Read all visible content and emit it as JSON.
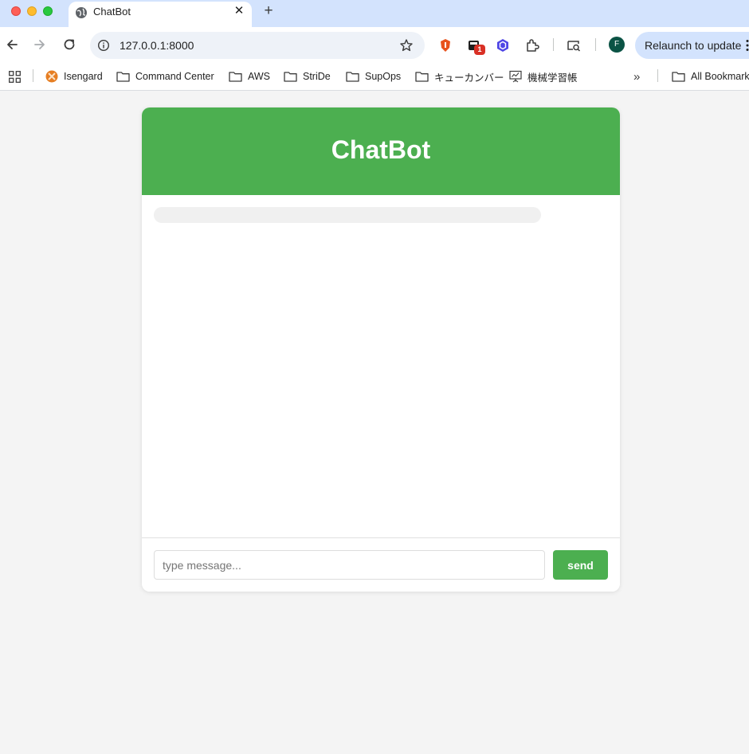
{
  "browser": {
    "tab": {
      "title": "ChatBot",
      "close_glyph": "✕",
      "favicon": "globe-icon"
    },
    "new_tab_glyph": "+",
    "address_bar": {
      "url": "127.0.0.1:8000"
    },
    "profile": {
      "initial": "F",
      "color": "#0b5345"
    },
    "extensions": [
      {
        "name": "brave-lion-icon",
        "color": "#e8531d"
      },
      {
        "name": "extension-badge-icon",
        "badge": "1"
      },
      {
        "name": "hexagon-extension-icon",
        "color": "#4f46e5"
      },
      {
        "name": "puzzle-icon"
      },
      {
        "name": "search-tab-icon"
      }
    ],
    "relaunch_label": "Relaunch to update",
    "bookmarks": [
      {
        "label": "Isengard",
        "icon": "isengard-icon"
      },
      {
        "label": "Command Center",
        "icon": "folder-icon"
      },
      {
        "label": "AWS",
        "icon": "folder-icon"
      },
      {
        "label": "StriDe",
        "icon": "folder-icon"
      },
      {
        "label": "SupOps",
        "icon": "folder-icon"
      },
      {
        "label": "キューカンバー",
        "icon": "folder-icon"
      },
      {
        "label": "機械学習帳",
        "icon": "presentation-icon"
      }
    ],
    "bookmarks_more_glyph": "»",
    "all_bookmarks_label": "All Bookmarks"
  },
  "chat": {
    "title": "ChatBot",
    "input_placeholder": "type message...",
    "send_label": "send",
    "accent_color": "#4caf50",
    "bubble_color": "#f0f0f0"
  }
}
